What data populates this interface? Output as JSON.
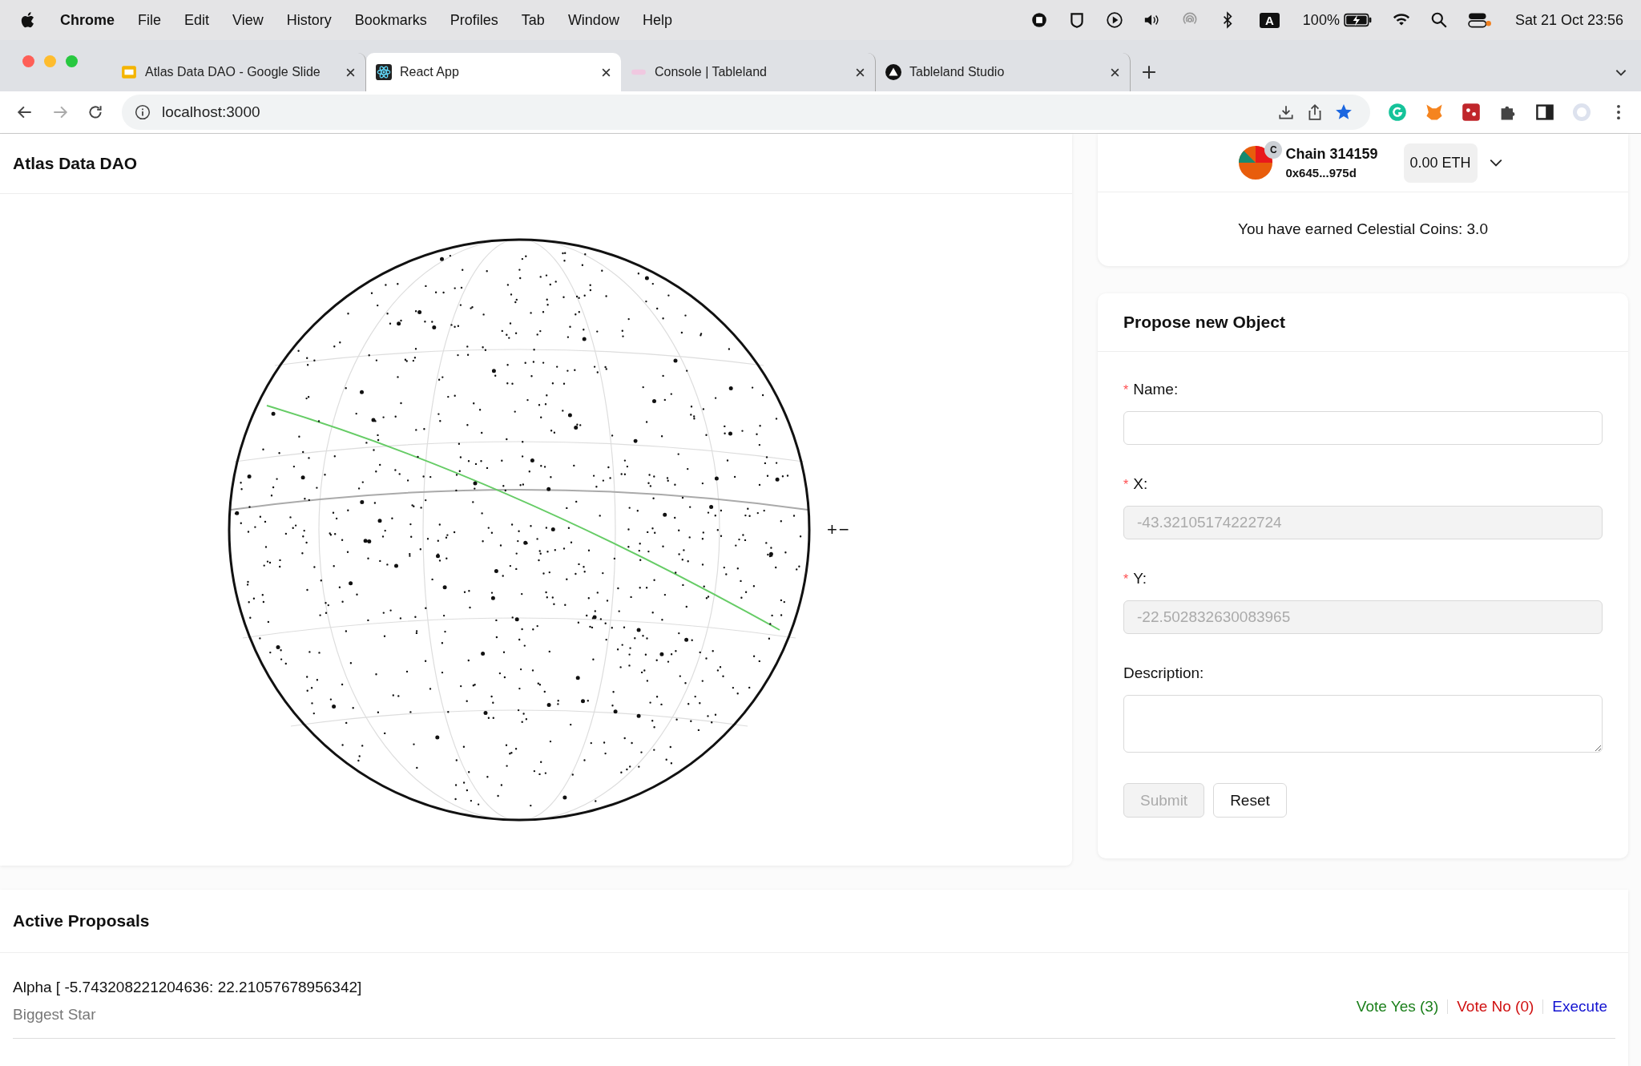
{
  "menu_bar": {
    "app": "Chrome",
    "items": [
      "File",
      "Edit",
      "View",
      "History",
      "Bookmarks",
      "Profiles",
      "Tab",
      "Window",
      "Help"
    ],
    "input_source": "A",
    "battery": "100%",
    "clock": "Sat 21 Oct  23:56"
  },
  "tabs": [
    {
      "title": "Atlas Data DAO - Google Slide",
      "kind": "slides",
      "selected": false
    },
    {
      "title": "React App",
      "kind": "react",
      "selected": true
    },
    {
      "title": "Console | Tableland",
      "kind": "console",
      "selected": false
    },
    {
      "title": "Tableland Studio",
      "kind": "studio",
      "selected": false
    }
  ],
  "address_bar": {
    "url": "localhost:3000"
  },
  "page": {
    "title": "Atlas Data DAO",
    "zoom_in": "+",
    "zoom_out": "−"
  },
  "wallet": {
    "chain": "Chain 314159",
    "address": "0x645...975d",
    "avatar_badge": "C",
    "balance": "0.00 ETH",
    "earned": "You have earned Celestial Coins: 3.0"
  },
  "form": {
    "title": "Propose new Object",
    "fields": [
      {
        "label": "Name:",
        "required_mark": "*",
        "kind": "input",
        "disabled": false
      },
      {
        "label": "X:",
        "required_mark": "*",
        "kind": "input",
        "value": "-43.32105174222724",
        "disabled": true
      },
      {
        "label": "Y:",
        "required_mark": "*",
        "kind": "input",
        "value": "-22.502832630083965",
        "disabled": true
      },
      {
        "label": "Description:",
        "kind": "textarea",
        "disabled": false
      }
    ],
    "buttons": [
      {
        "label": "Submit",
        "disabled": true
      },
      {
        "label": "Reset",
        "disabled": false
      }
    ]
  },
  "proposals": {
    "title": "Active Proposals",
    "items": [
      {
        "title": "Alpha [ -5.743208221204636: 22.21057678956342]",
        "description": "Biggest Star",
        "actions": [
          {
            "label": "Vote Yes (3)",
            "color": "#1a7f1a"
          },
          {
            "label": "Vote No (0)",
            "color": "#d01010"
          },
          {
            "label": "Execute",
            "color": "#1010d0"
          }
        ]
      }
    ]
  }
}
